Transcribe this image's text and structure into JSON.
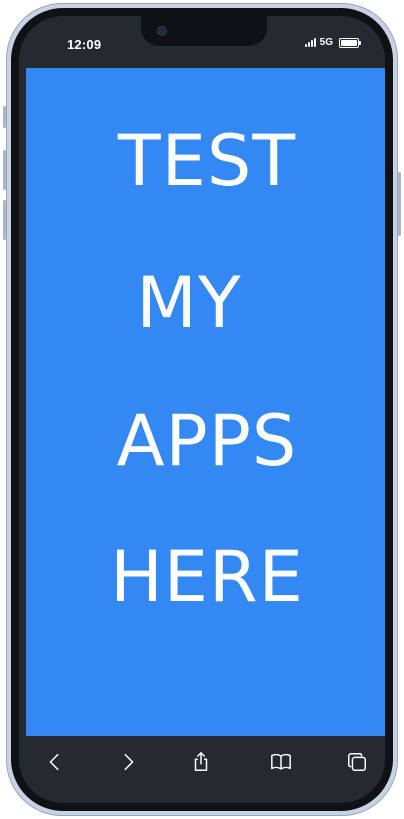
{
  "status_bar": {
    "time": "12:09",
    "network": "5G"
  },
  "page": {
    "background_color": "#3388f4",
    "lines": [
      "TEST",
      "MY",
      "APPS",
      "HERE"
    ]
  },
  "toolbar": {
    "icons": [
      "back-icon",
      "forward-icon",
      "share-icon",
      "bookmarks-icon",
      "tabs-icon"
    ]
  }
}
